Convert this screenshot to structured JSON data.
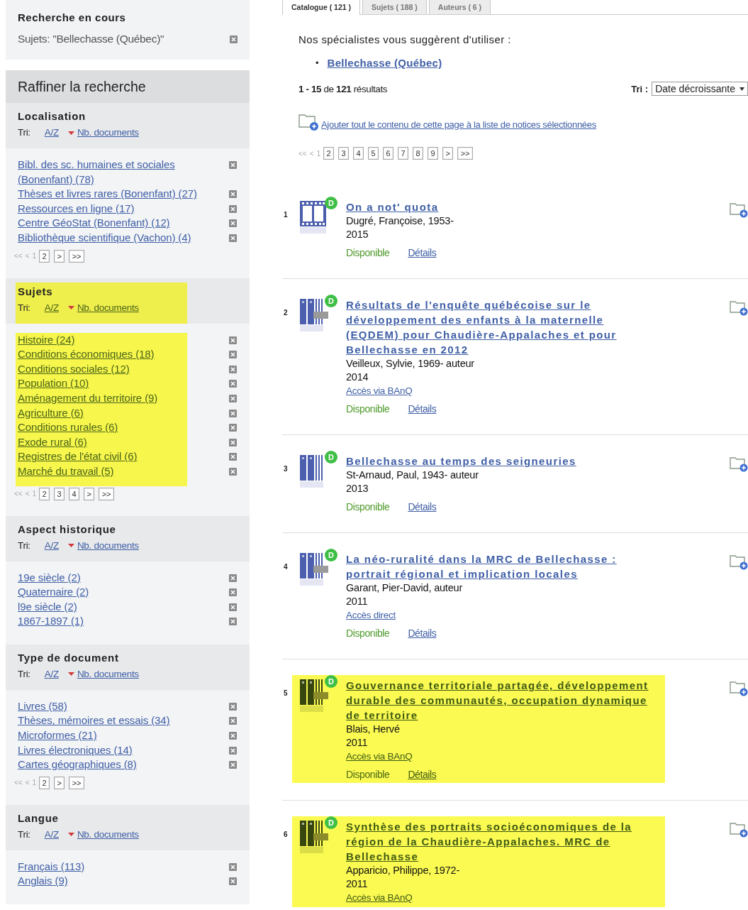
{
  "current_search": {
    "title": "Recherche en cours",
    "filters": [
      {
        "label": "Sujets: \"Bellechasse (Québec)\""
      }
    ]
  },
  "refine": {
    "title": "Raffiner la recherche",
    "facets": [
      {
        "title": "Localisation",
        "highlighted": false,
        "sort": {
          "label": "Tri:",
          "options": [
            {
              "label": "A/Z",
              "selected": false
            },
            {
              "label": "Nb. documents",
              "selected": true
            }
          ]
        },
        "items": [
          "Bibl. des sc. humaines et sociales (Bonenfant) (78)",
          "Thèses et livres rares (Bonenfant) (27)",
          "Ressources en ligne (17)",
          "Centre GéoStat (Bonenfant) (12)",
          "Bibliothèque scientifique (Vachon) (4)"
        ],
        "pager": {
          "first": "<<",
          "prev": "<",
          "current": "1",
          "pages": [
            "2"
          ],
          "next": ">",
          "last": ">>"
        }
      },
      {
        "title": "Sujets",
        "highlighted": true,
        "sort": {
          "label": "Tri:",
          "options": [
            {
              "label": "A/Z",
              "selected": false
            },
            {
              "label": "Nb. documents",
              "selected": true
            }
          ]
        },
        "items": [
          "Histoire (24)",
          "Conditions économiques (18)",
          "Conditions sociales (12)",
          "Population (10)",
          "Aménagement du territoire (9)",
          "Agriculture (6)",
          "Conditions rurales (6)",
          "Exode rural (6)",
          "Registres de l'état civil (6)",
          "Marché du travail (5)"
        ],
        "pager": {
          "first": "<<",
          "prev": "<",
          "current": "1",
          "pages": [
            "2",
            "3",
            "4"
          ],
          "next": ">",
          "last": ">>"
        }
      },
      {
        "title": "Aspect historique",
        "highlighted": false,
        "sort": {
          "label": "Tri:",
          "options": [
            {
              "label": "A/Z",
              "selected": false
            },
            {
              "label": "Nb. documents",
              "selected": true
            }
          ]
        },
        "items": [
          "19e siècle (2)",
          "Quaternaire (2)",
          "l9e siècle (2)",
          "1867-1897 (1)"
        ]
      },
      {
        "title": "Type de document",
        "highlighted": false,
        "sort": {
          "label": "Tri:",
          "options": [
            {
              "label": "A/Z",
              "selected": false
            },
            {
              "label": "Nb. documents",
              "selected": true
            }
          ]
        },
        "items": [
          "Livres (58)",
          "Thèses, mémoires et essais (34)",
          "Microformes (21)",
          "Livres électroniques (14)",
          "Cartes géographiques (8)"
        ],
        "pager": {
          "first": "<<",
          "prev": "<",
          "current": "1",
          "pages": [
            "2"
          ],
          "next": ">",
          "last": ">>"
        }
      },
      {
        "title": "Langue",
        "highlighted": false,
        "sort": {
          "label": "Tri:",
          "options": [
            {
              "label": "A/Z",
              "selected": false
            },
            {
              "label": "Nb. documents",
              "selected": true
            }
          ]
        },
        "items": [
          "Français (113)",
          "Anglais (9)"
        ]
      }
    ]
  },
  "tabs": [
    {
      "label": "Catalogue ( 121 )",
      "selected": true
    },
    {
      "label": "Sujets ( 188 )",
      "selected": false
    },
    {
      "label": "Auteurs ( 6 )",
      "selected": false
    }
  ],
  "suggestion": {
    "intro": "Nos spécialistes vous suggèrent d'utiliser :",
    "bullet": "•",
    "links": [
      "Bellechasse (Québec)"
    ]
  },
  "results_count": "**1 - 15** de **121** résultats",
  "sort": {
    "label": "Tri :",
    "value": "Date décroissante"
  },
  "add_all": "Ajouter tout le contenu de cette page à la liste de notices sélectionnées",
  "pager": {
    "first": "<<",
    "prev": "<",
    "current": "1",
    "pages": [
      "2",
      "3",
      "4",
      "5",
      "6",
      "7",
      "8",
      "9"
    ],
    "next": ">",
    "last": ">>"
  },
  "results": [
    {
      "number": "1",
      "kind": "video",
      "badge": "D",
      "title": "On a not' quota",
      "author": "Dugré, Françoise, 1953-",
      "year": "2015",
      "status": "Disponible",
      "details": "Détails",
      "highlighted": false
    },
    {
      "number": "2",
      "kind": "ebook",
      "badge": "D",
      "title": "Résultats de l'enquête québécoise sur le développement des enfants à la maternelle (EQDEM) pour Chaudière-Appalaches et pour Bellechasse en 2012",
      "author": "Veilleux, Sylvie, 1969- auteur",
      "year": "2014",
      "access": "Accès via BAnQ",
      "status": "Disponible",
      "details": "Détails",
      "highlighted": false
    },
    {
      "number": "3",
      "kind": "book",
      "badge": "D",
      "title": "Bellechasse au temps des seigneuries",
      "author": "St-Arnaud, Paul, 1943- auteur",
      "year": "2013",
      "status": "Disponible",
      "details": "Détails",
      "highlighted": false
    },
    {
      "number": "4",
      "kind": "ebook",
      "badge": "D",
      "title": "La néo-ruralité dans la MRC de Bellechasse : portrait régional et implication locales",
      "author": "Garant, Pier-David, auteur",
      "year": "2011",
      "access": "Accès direct",
      "status": "Disponible",
      "details": "Détails",
      "highlighted": false
    },
    {
      "number": "5",
      "kind": "ebook",
      "badge": "D",
      "title": "Gouvernance territoriale partagée, développement durable des communautés, occupation dynamique de territoire",
      "author": "Blais, Hervé",
      "year": "2011",
      "access": "Accès via BAnQ",
      "status": "Disponible",
      "details": "Détails",
      "highlighted": true
    },
    {
      "number": "6",
      "kind": "ebook",
      "badge": "D",
      "title": "Synthèse des portraits socioéconomiques de la région de la Chaudière-Appalaches. MRC de Bellechasse",
      "author": "Apparicio, Philippe, 1972-",
      "year": "2011",
      "access": "Accès via BAnQ",
      "highlighted": true
    }
  ]
}
